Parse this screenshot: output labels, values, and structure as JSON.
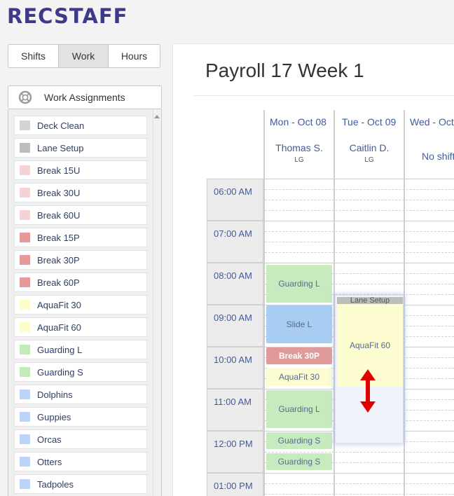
{
  "app": {
    "logo": "RECSTAFF"
  },
  "tabs": [
    {
      "label": "Shifts",
      "active": false
    },
    {
      "label": "Work",
      "active": true
    },
    {
      "label": "Hours",
      "active": false
    }
  ],
  "work_assignments": {
    "header": "Work Assignments",
    "header_icon": "lifebuoy-icon",
    "items": [
      {
        "label": "Deck Clean",
        "color": "#d3d3d3"
      },
      {
        "label": "Lane Setup",
        "color": "#bdbdbd"
      },
      {
        "label": "Break 15U",
        "color": "#f6d3d3"
      },
      {
        "label": "Break 30U",
        "color": "#f6d3d3"
      },
      {
        "label": "Break 60U",
        "color": "#f6d3d3"
      },
      {
        "label": "Break 15P",
        "color": "#e49a9a"
      },
      {
        "label": "Break 30P",
        "color": "#e49a9a"
      },
      {
        "label": "Break 60P",
        "color": "#e49a9a"
      },
      {
        "label": "AquaFit 30",
        "color": "#fdfdc9"
      },
      {
        "label": "AquaFit 60",
        "color": "#fdfdc9"
      },
      {
        "label": "Guarding L",
        "color": "#c1ebb8"
      },
      {
        "label": "Guarding S",
        "color": "#c1ebb8"
      },
      {
        "label": "Dolphins",
        "color": "#bcd4f7"
      },
      {
        "label": "Guppies",
        "color": "#bcd4f7"
      },
      {
        "label": "Orcas",
        "color": "#bcd4f7"
      },
      {
        "label": "Otters",
        "color": "#bcd4f7"
      },
      {
        "label": "Tadpoles",
        "color": "#bcd4f7"
      }
    ]
  },
  "schedule": {
    "title": "Payroll 17 Week 1",
    "days": [
      {
        "label": "Mon - Oct 08",
        "staff_name": "Thomas S.",
        "staff_role": "LG"
      },
      {
        "label": "Tue - Oct 09",
        "staff_name": "Caitlin D.",
        "staff_role": "LG"
      },
      {
        "label": "Wed - Oct",
        "no_shifts": "No shift"
      }
    ],
    "times": [
      "06:00 AM",
      "07:00 AM",
      "08:00 AM",
      "09:00 AM",
      "10:00 AM",
      "11:00 AM",
      "12:00 PM",
      "01:00 PM"
    ],
    "monday_events": [
      {
        "label": "Guarding L",
        "type": "green"
      },
      {
        "label": "Slide L",
        "type": "blue"
      },
      {
        "label": "Break 30P",
        "type": "red"
      },
      {
        "label": "AquaFit 30",
        "type": "yellow"
      },
      {
        "label": "Guarding L",
        "type": "green"
      },
      {
        "label": "Guarding S",
        "type": "green"
      },
      {
        "label": "Guarding S",
        "type": "green"
      }
    ],
    "tuesday_events": [
      {
        "label": "Lane Setup",
        "type": "gray"
      },
      {
        "label": "AquaFit 60",
        "type": "yellow"
      }
    ],
    "resize_indicator_icon": "vertical-resize-arrow-icon"
  },
  "colors": {
    "brand": "#3f3a87",
    "link": "#3f5a9e",
    "arrow": "#e00000"
  }
}
